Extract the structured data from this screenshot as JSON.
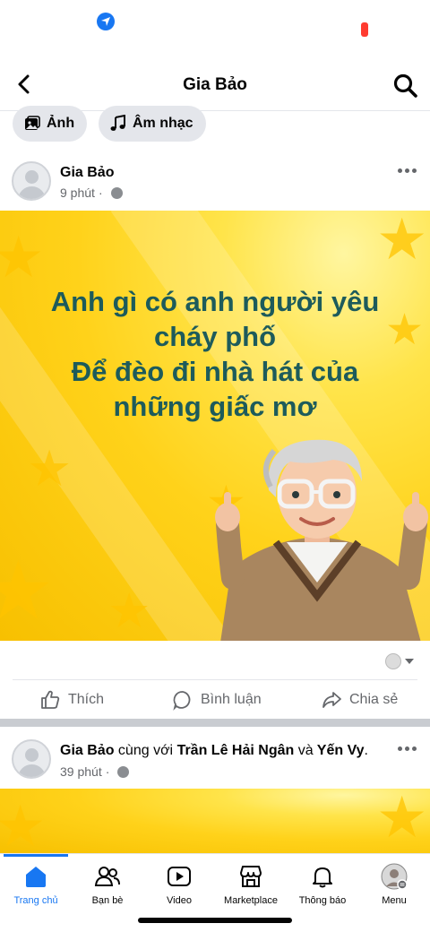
{
  "header": {
    "title": "Gia Bảo"
  },
  "chips": [
    {
      "label": "Ảnh",
      "icon": "photo-icon"
    },
    {
      "label": "Âm nhạc",
      "icon": "music-note-icon"
    }
  ],
  "posts": [
    {
      "author": "Gia Bảo",
      "time": "9 phút",
      "privacy_icon": "globe-icon",
      "image_text_lines": [
        "Anh gì có anh người yêu",
        "cháy phố",
        "Để đèo đi nhà hát của",
        "những giấc mơ"
      ],
      "image_colors": {
        "background": "#ffd21a",
        "text": "#1d5b5b"
      },
      "actions": {
        "like": "Thích",
        "comment": "Bình luận",
        "share": "Chia sẻ"
      }
    },
    {
      "author": "Gia Bảo",
      "with_text": "cùng với",
      "tagged_1": "Trần Lê Hải Ngân",
      "and_text": "và",
      "tagged_2": "Yến Vy",
      "period": ".",
      "time": "39 phút",
      "privacy_icon": "globe-icon"
    }
  ],
  "bottom_nav": [
    {
      "label": "Trang chủ",
      "icon": "home-icon",
      "active": true
    },
    {
      "label": "Bạn bè",
      "icon": "friends-icon",
      "active": false
    },
    {
      "label": "Video",
      "icon": "video-icon",
      "active": false
    },
    {
      "label": "Marketplace",
      "icon": "marketplace-icon",
      "active": false
    },
    {
      "label": "Thông báo",
      "icon": "bell-icon",
      "active": false
    },
    {
      "label": "Menu",
      "icon": "profile-avatar",
      "active": false
    }
  ],
  "colors": {
    "accent": "#1877f2",
    "secondary_text": "#65676b",
    "divider": "#c9ccd1"
  }
}
